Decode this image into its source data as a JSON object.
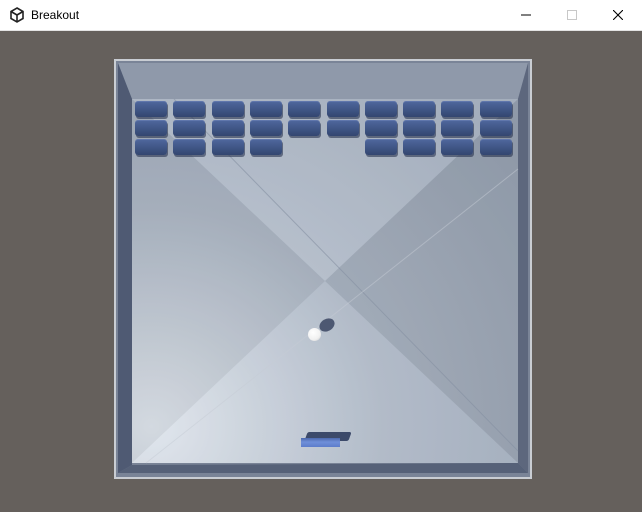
{
  "window": {
    "title": "Breakout",
    "app_icon": "unity-logo-icon",
    "buttons": {
      "minimize": "minimize-icon",
      "maximize": "maximize-icon",
      "close": "close-icon"
    }
  },
  "game": {
    "brick_color": "#3f5585",
    "paddle_color": "#5c7ccb",
    "ball_color": "#f5f5f5",
    "board_color": "#a9b4c2",
    "brick_grid": {
      "rows": 3,
      "columns": 10,
      "present": [
        [
          1,
          1,
          1,
          1,
          1,
          1,
          1,
          1,
          1,
          1
        ],
        [
          1,
          1,
          1,
          1,
          1,
          1,
          1,
          1,
          1,
          1
        ],
        [
          1,
          1,
          1,
          1,
          0,
          0,
          1,
          1,
          1,
          1
        ]
      ]
    }
  }
}
